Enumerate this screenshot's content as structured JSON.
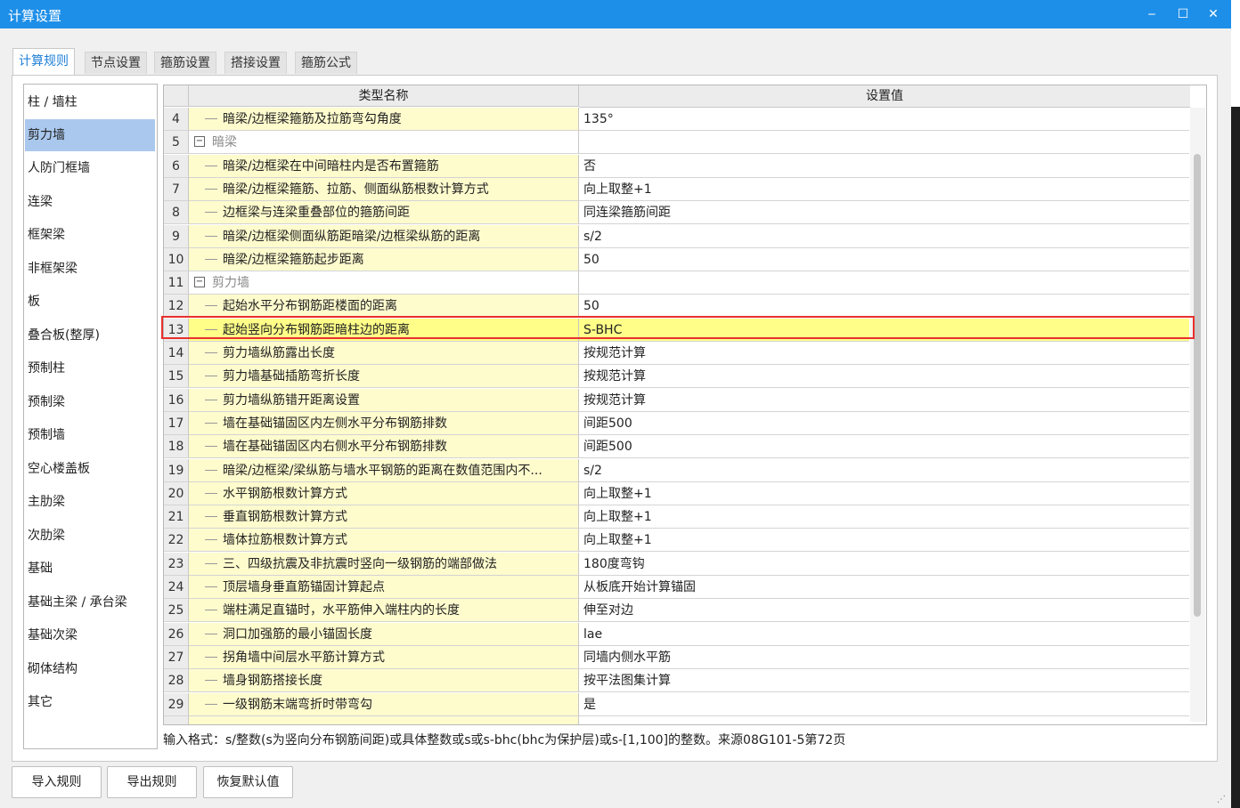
{
  "window": {
    "title": "计算设置",
    "minimize": "‒",
    "maximize": "☐",
    "close": "✕"
  },
  "tabs": [
    "计算规则",
    "节点设置",
    "箍筋设置",
    "搭接设置",
    "箍筋公式"
  ],
  "active_tab": 0,
  "sidebar": {
    "items": [
      "柱 / 墙柱",
      "剪力墙",
      "人防门框墙",
      "连梁",
      "框架梁",
      "非框架梁",
      "板",
      "叠合板(整厚)",
      "预制柱",
      "预制梁",
      "预制墙",
      "空心楼盖板",
      "主肋梁",
      "次肋梁",
      "基础",
      "基础主梁 / 承台梁",
      "基础次梁",
      "砌体结构",
      "其它"
    ],
    "selected": 1
  },
  "grid": {
    "headers": {
      "name": "类型名称",
      "value": "设置值"
    },
    "rows": [
      {
        "num": "4",
        "name": "暗梁/边框梁箍筋及拉筋弯勾角度",
        "value": "135°"
      },
      {
        "num": "5",
        "name": "暗梁",
        "value": "",
        "group": true,
        "expander": "−"
      },
      {
        "num": "6",
        "name": "暗梁/边框梁在中间暗柱内是否布置箍筋",
        "value": "否"
      },
      {
        "num": "7",
        "name": "暗梁/边框梁箍筋、拉筋、侧面纵筋根数计算方式",
        "value": "向上取整+1"
      },
      {
        "num": "8",
        "name": "边框梁与连梁重叠部位的箍筋间距",
        "value": "同连梁箍筋间距"
      },
      {
        "num": "9",
        "name": "暗梁/边框梁侧面纵筋距暗梁/边框梁纵筋的距离",
        "value": "s/2"
      },
      {
        "num": "10",
        "name": "暗梁/边框梁箍筋起步距离",
        "value": "50"
      },
      {
        "num": "11",
        "name": "剪力墙",
        "value": "",
        "group": true,
        "expander": "−"
      },
      {
        "num": "12",
        "name": "起始水平分布钢筋距楼面的距离",
        "value": "50"
      },
      {
        "num": "13",
        "name": "起始竖向分布钢筋距暗柱边的距离",
        "value": "S-BHC",
        "highlight": true
      },
      {
        "num": "14",
        "name": "剪力墙纵筋露出长度",
        "value": "按规范计算"
      },
      {
        "num": "15",
        "name": "剪力墙基础插筋弯折长度",
        "value": "按规范计算"
      },
      {
        "num": "16",
        "name": "剪力墙纵筋错开距离设置",
        "value": "按规范计算"
      },
      {
        "num": "17",
        "name": "墙在基础锚固区内左侧水平分布钢筋排数",
        "value": "间距500"
      },
      {
        "num": "18",
        "name": "墙在基础锚固区内右侧水平分布钢筋排数",
        "value": "间距500"
      },
      {
        "num": "19",
        "name": "暗梁/边框梁/梁纵筋与墙水平钢筋的距离在数值范围内不...",
        "value": "s/2"
      },
      {
        "num": "20",
        "name": "水平钢筋根数计算方式",
        "value": "向上取整+1"
      },
      {
        "num": "21",
        "name": "垂直钢筋根数计算方式",
        "value": "向上取整+1"
      },
      {
        "num": "22",
        "name": "墙体拉筋根数计算方式",
        "value": "向上取整+1"
      },
      {
        "num": "23",
        "name": "三、四级抗震及非抗震时竖向一级钢筋的端部做法",
        "value": "180度弯钩"
      },
      {
        "num": "24",
        "name": "顶层墙身垂直筋锚固计算起点",
        "value": "从板底开始计算锚固"
      },
      {
        "num": "25",
        "name": "端柱满足直锚时，水平筋伸入端柱内的长度",
        "value": "伸至对边"
      },
      {
        "num": "26",
        "name": "洞口加强筋的最小锚固长度",
        "value": "lae"
      },
      {
        "num": "27",
        "name": "拐角墙中间层水平筋计算方式",
        "value": "同墙内侧水平筋"
      },
      {
        "num": "28",
        "name": "墙身钢筋搭接长度",
        "value": "按平法图集计算"
      },
      {
        "num": "29",
        "name": "一级钢筋末端弯折时带弯勾",
        "value": "是"
      }
    ]
  },
  "hint": "输入格式：s/整数(s为竖向分布钢筋间距)或具体整数或s或s-bhc(bhc为保护层)或s-[1,100]的整数。来源08G101-5第72页",
  "buttons": {
    "import": "导入规则",
    "export": "导出规则",
    "restore": "恢复默认值"
  },
  "colors": {
    "titlebar": "#1e8fe8",
    "name_column": "#fefbcd",
    "highlight_row": "#fefe88",
    "highlight_border": "#e8302e",
    "sidebar_selected": "#aac8ee",
    "active_tab_text": "#1e7fd8"
  }
}
